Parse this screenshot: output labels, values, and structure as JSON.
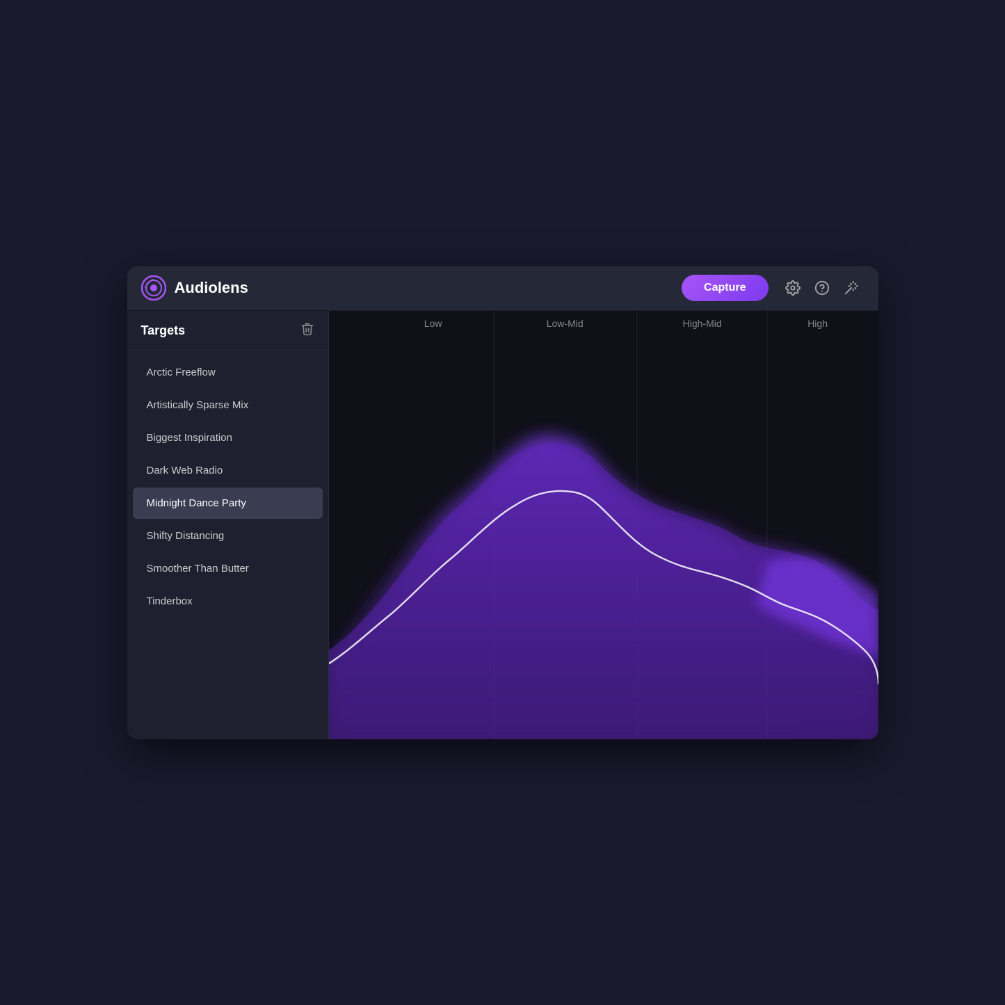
{
  "app": {
    "title": "Audiolens",
    "capture_label": "Capture"
  },
  "sidebar": {
    "header_label": "Targets",
    "items": [
      {
        "id": "arctic-freeflow",
        "label": "Arctic Freeflow",
        "active": false
      },
      {
        "id": "artistically-sparse-mix",
        "label": "Artistically Sparse Mix",
        "active": false
      },
      {
        "id": "biggest-inspiration",
        "label": "Biggest Inspiration",
        "active": false
      },
      {
        "id": "dark-web-radio",
        "label": "Dark Web Radio",
        "active": false
      },
      {
        "id": "midnight-dance-party",
        "label": "Midnight Dance Party",
        "active": true
      },
      {
        "id": "shifty-distancing",
        "label": "Shifty Distancing",
        "active": false
      },
      {
        "id": "smoother-than-butter",
        "label": "Smoother Than Butter",
        "active": false
      },
      {
        "id": "tinderbox",
        "label": "Tinderbox",
        "active": false
      }
    ]
  },
  "chart": {
    "freq_labels": [
      {
        "label": "Low",
        "left_pct": 19
      },
      {
        "label": "Low-Mid",
        "left_pct": 43
      },
      {
        "label": "High-Mid",
        "left_pct": 68
      },
      {
        "label": "High",
        "left_pct": 89
      }
    ],
    "dividers": [
      30,
      56,
      80
    ]
  },
  "icons": {
    "settings": "⚙",
    "help": "?",
    "delete": "🗑"
  }
}
